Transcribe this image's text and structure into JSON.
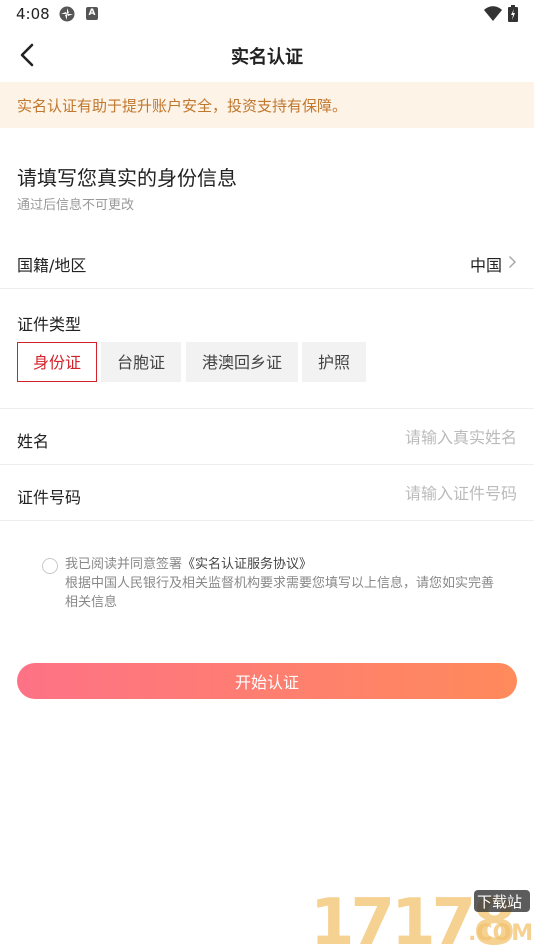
{
  "status_bar": {
    "time": "4:08",
    "icons": [
      "settings-gear-icon",
      "app-badge-icon",
      "wifi-icon",
      "battery-icon"
    ],
    "badge_letter": "A"
  },
  "nav": {
    "title": "实名认证",
    "back_icon": "chevron-left-icon"
  },
  "notice": {
    "text": "实名认证有助于提升账户安全，投资支持有保障。",
    "color": "#c0772e",
    "background": "#fdf3e7"
  },
  "form": {
    "heading": "请填写您真实的身份信息",
    "subheading": "通过后信息不可更改",
    "region": {
      "label": "国籍/地区",
      "value": "中国"
    },
    "id_type": {
      "label": "证件类型",
      "options": [
        "身份证",
        "台胞证",
        "港澳回乡证",
        "护照"
      ],
      "selected": "身份证"
    },
    "name": {
      "label": "姓名",
      "placeholder": "请输入真实姓名",
      "value": ""
    },
    "id_number": {
      "label": "证件号码",
      "placeholder": "请输入证件号码",
      "value": ""
    }
  },
  "agreement": {
    "prefix": "我已阅读并同意签署",
    "link": "《实名认证服务协议》",
    "description": "根据中国人民银行及相关监督机构要求需要您填写以上信息，请您如实完善相关信息",
    "checked": false
  },
  "submit": {
    "label": "开始认证",
    "gradient": [
      "#fe7286",
      "#ff8a5b"
    ]
  },
  "watermark": {
    "text": "17178",
    "sub_top": "下载站",
    "sub_bottom": ".COM"
  },
  "colors": {
    "accent": "#d2232a"
  }
}
